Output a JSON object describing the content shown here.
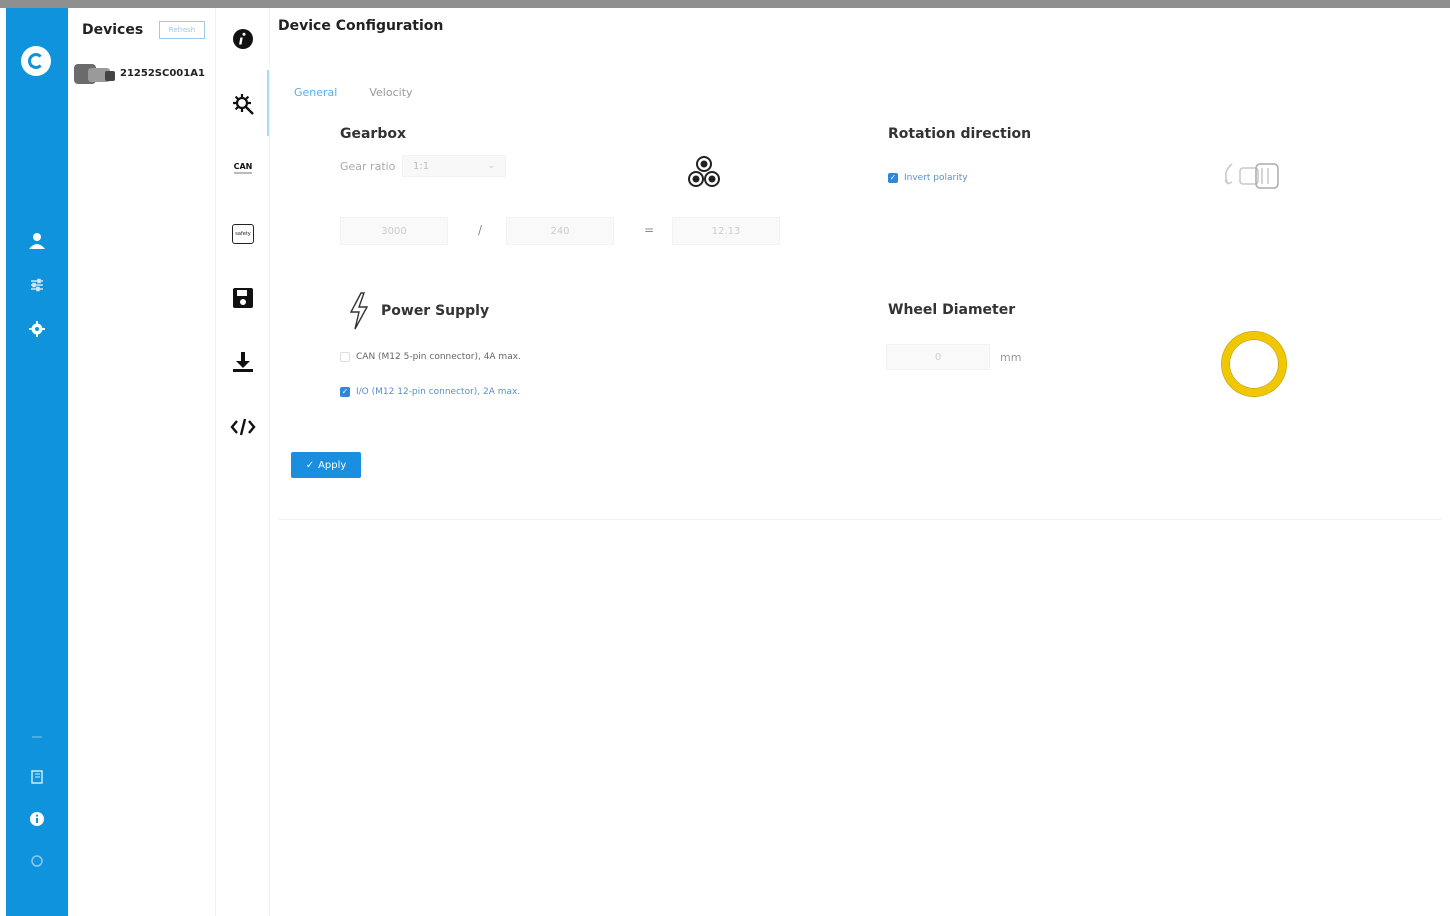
{
  "devices_panel": {
    "title": "Devices",
    "refresh_label": "Refresh",
    "device_id": "21252SC001A1"
  },
  "rail": {
    "icons": [
      "user-icon",
      "sliders-icon",
      "gear-icon",
      "book-icon",
      "info-icon",
      "power-icon"
    ]
  },
  "toolbar": {
    "icons": [
      "info-icon",
      "settings-gear-icon",
      "can-icon",
      "safety-icon",
      "save-icon",
      "download-icon",
      "code-icon"
    ],
    "can_label": "CAN",
    "safety_label": "safety"
  },
  "page": {
    "title": "Device Configuration"
  },
  "tabs": [
    {
      "label": "General",
      "active": true
    },
    {
      "label": "Velocity",
      "active": false
    }
  ],
  "gearbox": {
    "title": "Gearbox",
    "gear_ratio_label": "Gear ratio",
    "gear_ratio_value": "1:1",
    "numerator": "3000",
    "denominator": "240",
    "result": "12.13",
    "divide_op": "/",
    "equals_op": "="
  },
  "rotation": {
    "title": "Rotation direction",
    "invert_polarity_label": "Invert polarity",
    "invert_polarity_checked": true
  },
  "power_supply": {
    "title": "Power Supply",
    "options": [
      {
        "label": "CAN (M12 5-pin connector), 4A max.",
        "checked": false
      },
      {
        "label": "I/O (M12 12-pin connector), 2A max.",
        "checked": true
      }
    ]
  },
  "wheel": {
    "title": "Wheel Diameter",
    "value": "0",
    "unit": "mm"
  },
  "apply_label": "Apply",
  "colors": {
    "rail": "#0e93dc",
    "accent": "#1a8fe0",
    "wheel": "#f0c800"
  }
}
